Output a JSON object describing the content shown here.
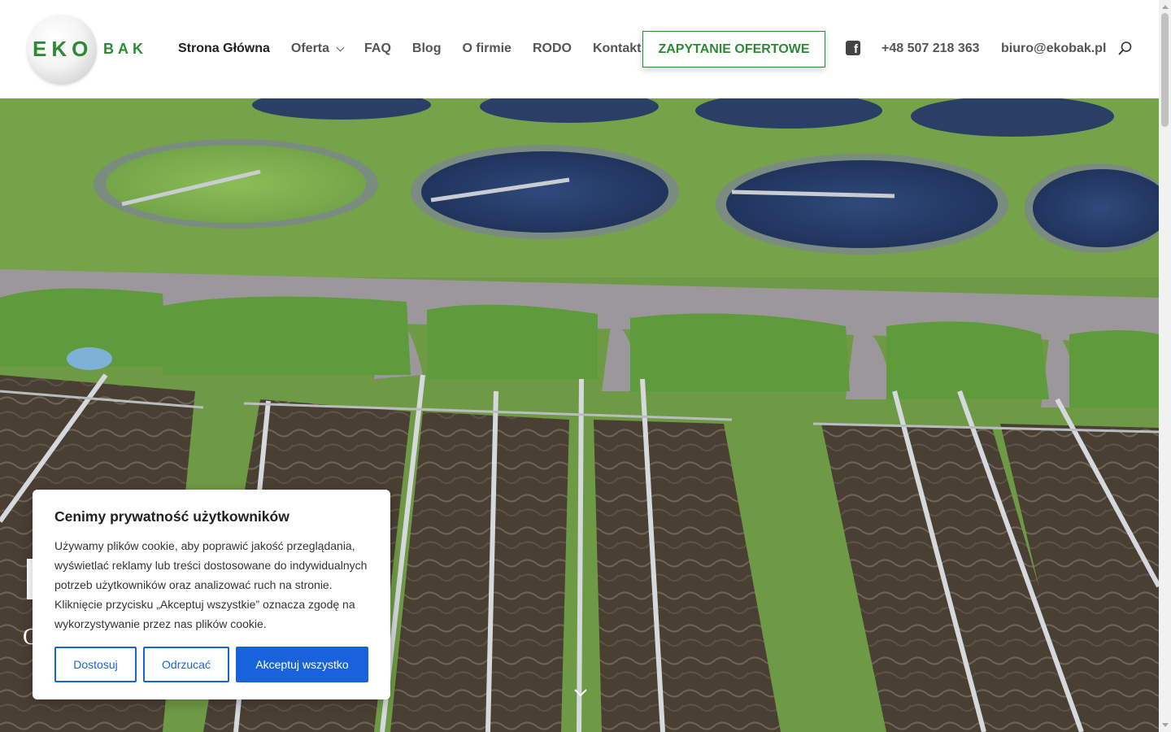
{
  "logo": {
    "eko": "EKO",
    "bak": "BAK",
    "brand_color": "#2d8a34"
  },
  "nav": {
    "items": [
      {
        "label": "Strona Główna",
        "active": true
      },
      {
        "label": "Oferta",
        "has_dropdown": true
      },
      {
        "label": "FAQ"
      },
      {
        "label": "Blog"
      },
      {
        "label": "O firmie"
      },
      {
        "label": "RODO"
      },
      {
        "label": "Kontakt"
      }
    ]
  },
  "cta": {
    "label": "ZAPYTANIE OFERTOWE"
  },
  "contact": {
    "facebook_icon": "facebook-icon",
    "phone": "+48 507 218 363",
    "email": "biuro@ekobak.pl",
    "search_icon": "search-icon"
  },
  "hero": {
    "image": "aerial view of wastewater treatment plant",
    "fragment_text": "C"
  },
  "cookie": {
    "title": "Cenimy prywatność użytkowników",
    "text": "Używamy plików cookie, aby poprawić jakość przeglądania, wyświetlać reklamy lub treści dostosowane do indywidualnych potrzeb użytkowników oraz analizować ruch na stronie. Kliknięcie przycisku „Akceptuj wszystkie” oznacza zgodę na wykorzystywanie przez nas plików cookie.",
    "buttons": {
      "customize": "Dostosuj",
      "reject": "Odrzucać",
      "accept": "Akceptuj wszystko"
    },
    "accent": "#1863dc"
  }
}
